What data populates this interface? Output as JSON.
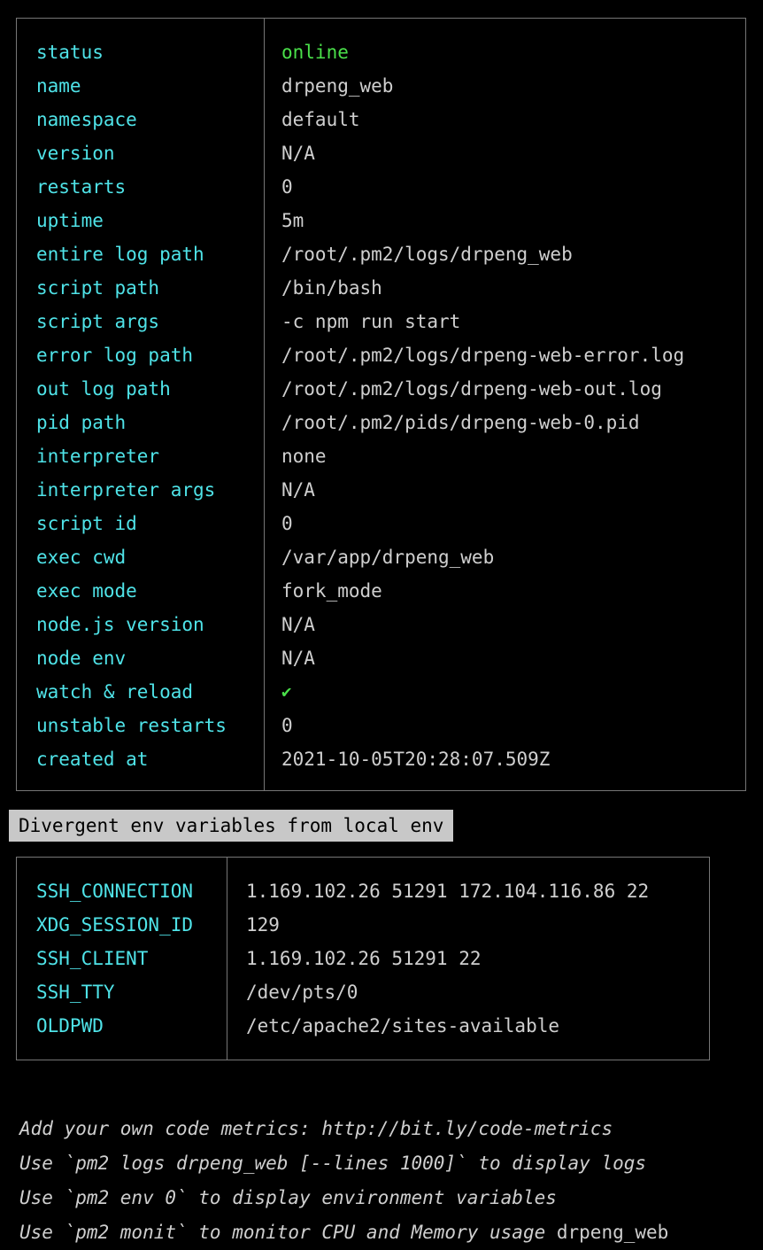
{
  "theme": {
    "background": "#000000",
    "label_color": "#4fe3e8",
    "value_color": "#cfcfcf",
    "status_online_color": "#4ae04a",
    "border_color": "#767676",
    "heading_bg": "#c8c8c8",
    "heading_fg": "#000000"
  },
  "process_table": {
    "rows": [
      {
        "key": "status",
        "value": "online",
        "style": "online"
      },
      {
        "key": "name",
        "value": "drpeng_web",
        "style": "plain"
      },
      {
        "key": "namespace",
        "value": "default",
        "style": "plain"
      },
      {
        "key": "version",
        "value": "N/A",
        "style": "plain"
      },
      {
        "key": "restarts",
        "value": "0",
        "style": "plain"
      },
      {
        "key": "uptime",
        "value": "5m",
        "style": "plain"
      },
      {
        "key": "entire log path",
        "value": "/root/.pm2/logs/drpeng_web",
        "style": "plain"
      },
      {
        "key": "script path",
        "value": "/bin/bash",
        "style": "plain"
      },
      {
        "key": "script args",
        "value": "-c npm run start",
        "style": "plain"
      },
      {
        "key": "error log path",
        "value": "/root/.pm2/logs/drpeng-web-error.log",
        "style": "plain"
      },
      {
        "key": "out log path",
        "value": "/root/.pm2/logs/drpeng-web-out.log",
        "style": "plain"
      },
      {
        "key": "pid path",
        "value": "/root/.pm2/pids/drpeng-web-0.pid",
        "style": "plain"
      },
      {
        "key": "interpreter",
        "value": "none",
        "style": "plain"
      },
      {
        "key": "interpreter args",
        "value": "N/A",
        "style": "plain"
      },
      {
        "key": "script id",
        "value": "0",
        "style": "plain"
      },
      {
        "key": "exec cwd",
        "value": "/var/app/drpeng_web",
        "style": "plain"
      },
      {
        "key": "exec mode",
        "value": "fork_mode",
        "style": "plain"
      },
      {
        "key": "node.js version",
        "value": "N/A",
        "style": "plain"
      },
      {
        "key": "node env",
        "value": "N/A",
        "style": "plain"
      },
      {
        "key": "watch & reload",
        "value": "✔",
        "style": "check"
      },
      {
        "key": "unstable restarts",
        "value": "0",
        "style": "plain"
      },
      {
        "key": "created at",
        "value": "2021-10-05T20:28:07.509Z",
        "style": "plain"
      }
    ]
  },
  "env_section": {
    "heading": "Divergent env variables from local env",
    "rows": [
      {
        "key": "SSH_CONNECTION",
        "value": "1.169.102.26 51291 172.104.116.86 22"
      },
      {
        "key": "XDG_SESSION_ID",
        "value": "129"
      },
      {
        "key": "SSH_CLIENT",
        "value": "1.169.102.26 51291 22"
      },
      {
        "key": "SSH_TTY",
        "value": "/dev/pts/0"
      },
      {
        "key": "OLDPWD",
        "value": "/etc/apache2/sites-available"
      }
    ]
  },
  "hints": [
    {
      "italic": "Add your own code metrics: http://bit.ly/code-metrics",
      "upright": ""
    },
    {
      "italic": "Use `pm2 logs drpeng_web [--lines 1000]` to display logs",
      "upright": ""
    },
    {
      "italic": "Use `pm2 env 0` to display environment variables",
      "upright": ""
    },
    {
      "italic": "Use `pm2 monit` to monitor CPU and Memory usage",
      "upright": " drpeng_web"
    }
  ]
}
